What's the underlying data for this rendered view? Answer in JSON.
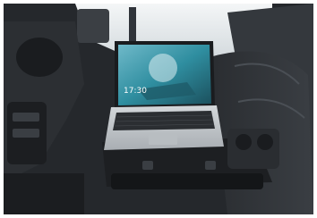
{
  "scene": {
    "subject": "laptop-on-vehicle-dashboard-mount",
    "screen_time": "17:30"
  },
  "colors": {
    "cabin_dark": "#23262a",
    "window_light": "#e8ecef",
    "laptop_silver": "#c9cdd1",
    "screen_teal": "#2f8ea0"
  }
}
